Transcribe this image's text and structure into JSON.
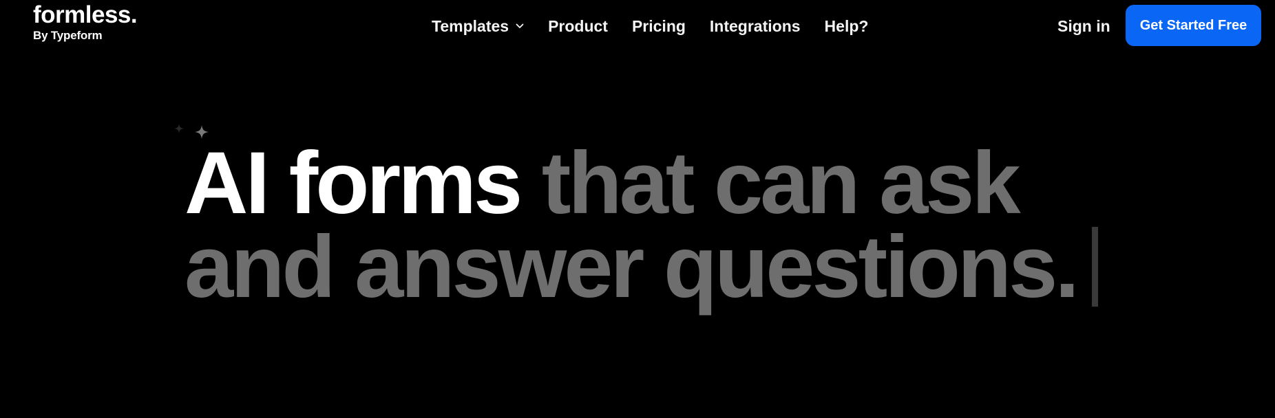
{
  "brand": {
    "name": "formless.",
    "byline": "By Typeform"
  },
  "nav": {
    "items": [
      {
        "label": "Templates",
        "has_dropdown": true
      },
      {
        "label": "Product"
      },
      {
        "label": "Pricing"
      },
      {
        "label": "Integrations"
      },
      {
        "label": "Help?"
      }
    ],
    "dropdown_icon": "chevron-down-icon"
  },
  "auth": {
    "sign_in": "Sign in",
    "cta": "Get Started Free"
  },
  "hero": {
    "icon": "sparkles-icon",
    "highlight": "AI forms",
    "rest_line1": "that can ask",
    "line2": "and answer questions."
  },
  "colors": {
    "background": "#000000",
    "accent": "#0a66f5",
    "muted_text": "#6e6e6e",
    "text": "#ffffff"
  }
}
